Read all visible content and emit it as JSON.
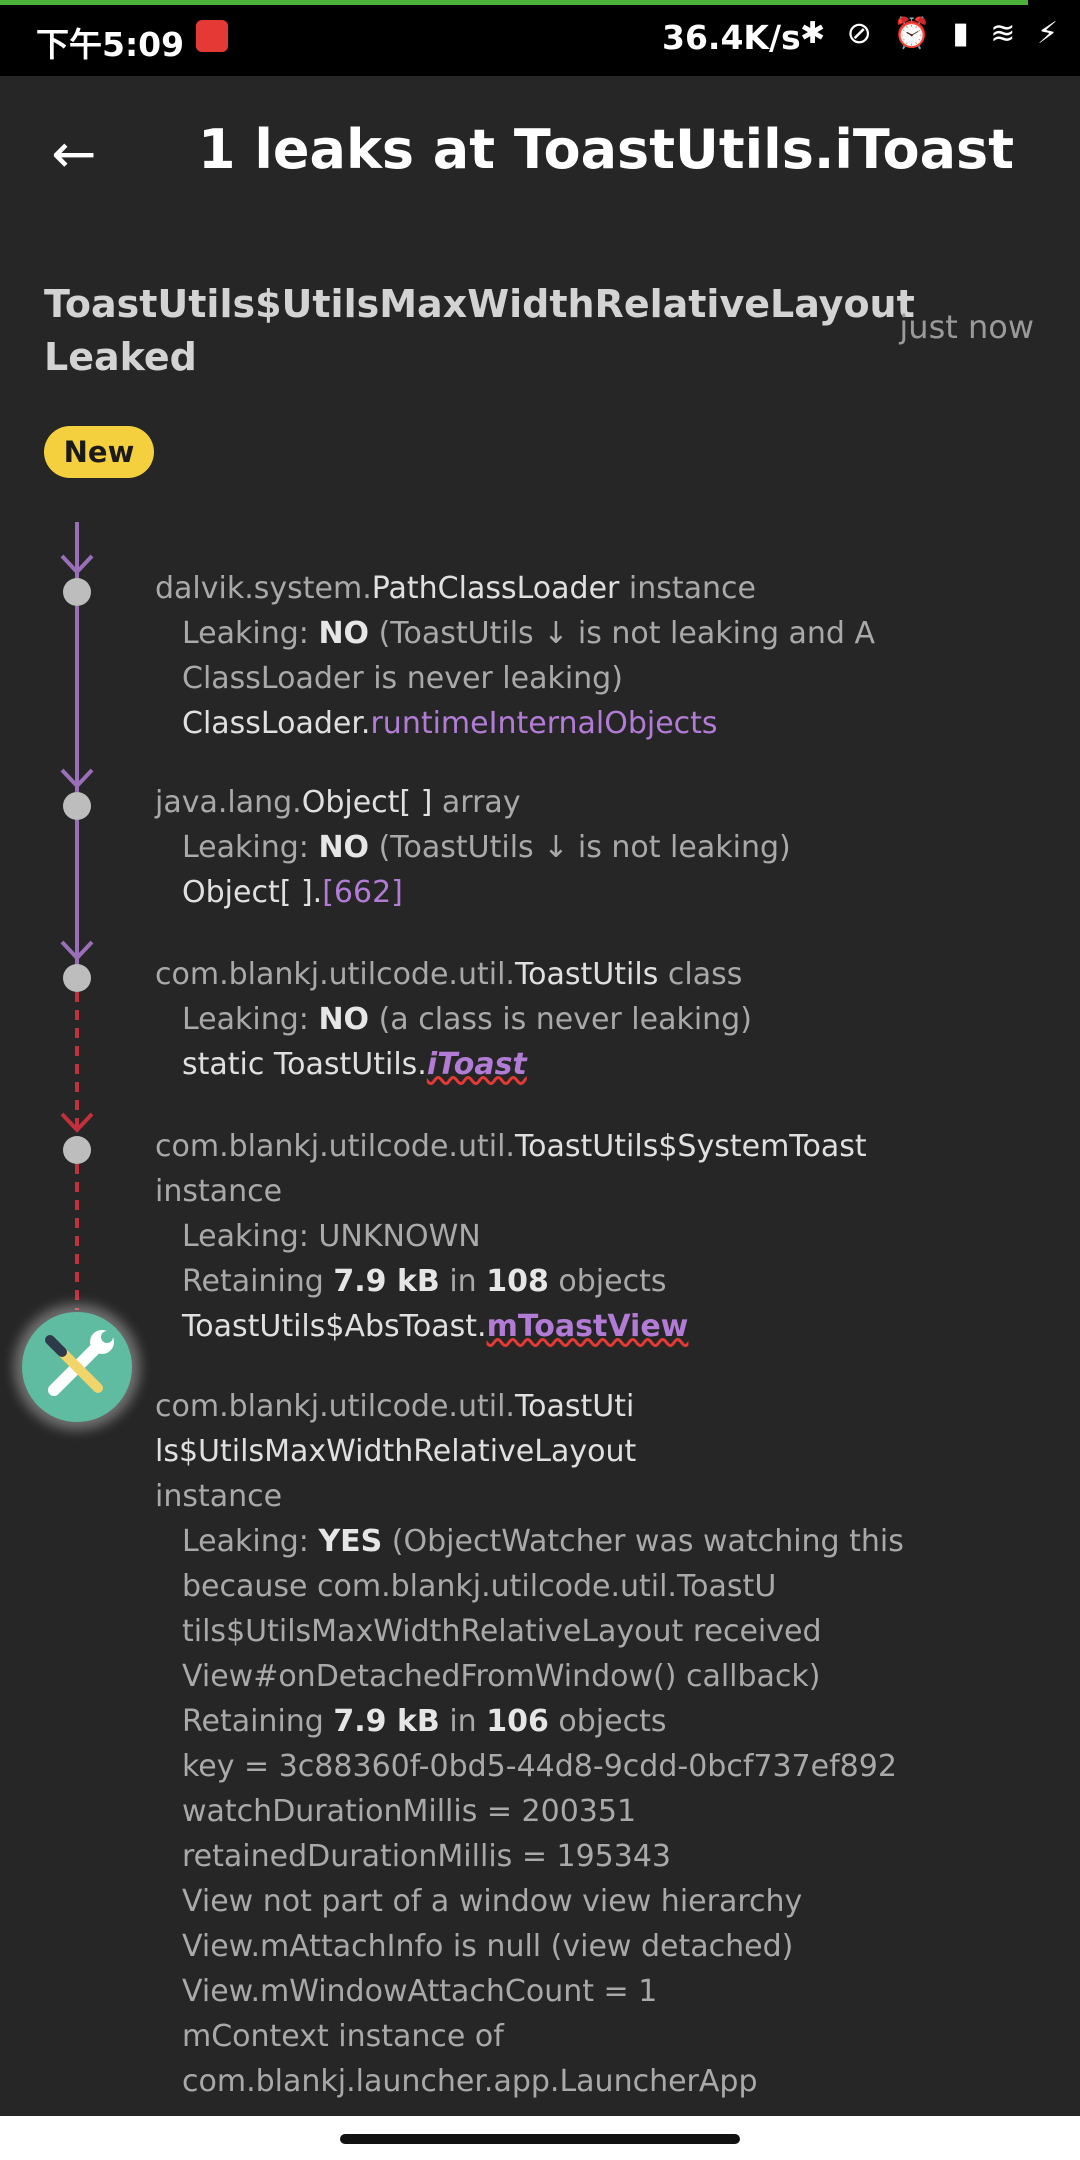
{
  "status_bar": {
    "time": "下午5:09",
    "speed": "36.4K/s",
    "icons": [
      "bluetooth-icon",
      "mute-icon",
      "alarm-icon",
      "hd-signal-icon",
      "wifi-icon",
      "charging-icon"
    ],
    "icon_text": "✱ ⊘ ⏰ ▮ ≋ ⚡"
  },
  "header": {
    "back_icon": "←",
    "title": "1 leaks at ToastUtils.iToast"
  },
  "leak": {
    "class_name": "ToastUtils$UtilsMaxWidthRelativeLayout",
    "leaked_label": "Leaked",
    "time": "just now",
    "badge": "New"
  },
  "trace": [
    {
      "package": "dalvik.system.",
      "class": "PathClassLoader",
      "kind": " instance",
      "leaking_label": "Leaking: ",
      "leaking_value": "NO",
      "leaking_reason": " (ToastUtils ↓ is not leaking and A ClassLoader is never leaking)",
      "ref_owner": "ClassLoader.",
      "ref_field": "runtimeInternalObjects"
    },
    {
      "package": "java.lang.",
      "class": "Object[ ]",
      "kind": " array",
      "leaking_label": "Leaking: ",
      "leaking_value": "NO",
      "leaking_reason": " (ToastUtils ↓ is not leaking)",
      "ref_owner": "Object[ ].",
      "ref_field": "[662]"
    },
    {
      "package": "com.blankj.utilcode.util.",
      "class": "ToastUtils",
      "kind": " class",
      "leaking_label": "Leaking: ",
      "leaking_value": "NO",
      "leaking_reason": " (a class is never leaking)",
      "ref_owner": "static ToastUtils.",
      "ref_field": "iToast"
    },
    {
      "package": "com.blankj.utilcode.util.",
      "class": "ToastUtils$SystemToast",
      "kind": "instance",
      "leaking_text": "Leaking: UNKNOWN",
      "retaining_pre": "Retaining ",
      "retaining_size": "7.9 kB",
      "retaining_mid": " in ",
      "retaining_count": "108",
      "retaining_post": " objects",
      "ref_owner": "ToastUtils$AbsToast.",
      "ref_field": "mToastView"
    },
    {
      "package": "com.blankj.utilcode.util.",
      "class_line1": "ToastUti",
      "class_line2": "ls$UtilsMaxWidthRelativeLayout",
      "kind": "instance",
      "leaking_label": "Leaking: ",
      "leaking_value": "YES",
      "leaking_reason": " (ObjectWatcher was watching this because com.blankj.utilcode.util.ToastU tils$UtilsMaxWidthRelativeLayout received View#onDetachedFromWindow() callback)",
      "retaining_pre": "Retaining ",
      "retaining_size": "7.9 kB",
      "retaining_mid": " in ",
      "retaining_count": "106",
      "retaining_post": " objects",
      "key": "key = 3c88360f-0bd5-44d8-9cdd-0bcf737ef892",
      "watch": "watchDurationMillis = 200351",
      "retained": "retainedDurationMillis = 195343",
      "not_part": "View not part of a window view hierarchy",
      "attach_info": "View.mAttachInfo is null (view detached)",
      "attach_count": "View.mWindowAttachCount = 1",
      "context": "mContext instance of com.blankj.launcher.app.LauncherApp"
    }
  ],
  "fab_icon": "wrench-screwdriver-icon",
  "colors": {
    "background": "#262626",
    "purple": "#b27cd6",
    "red": "#c2303c",
    "badge": "#f4d03f",
    "fab": "#5fbca0"
  }
}
